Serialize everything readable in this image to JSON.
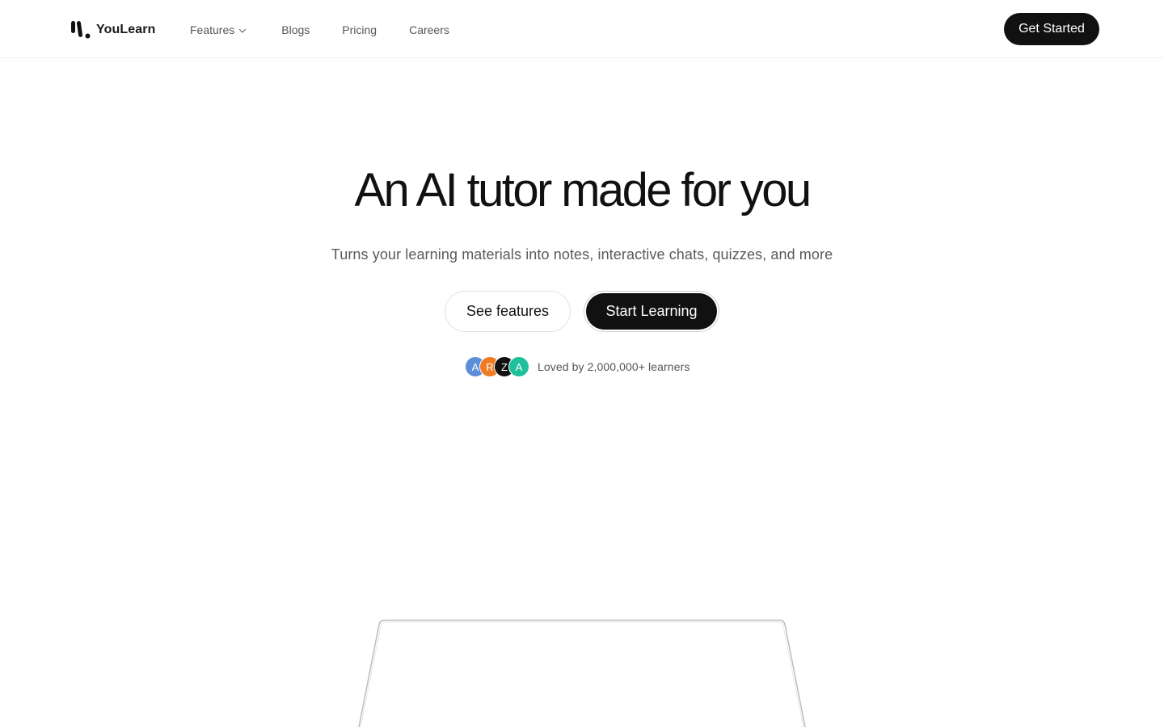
{
  "brand": {
    "name": "YouLearn"
  },
  "nav": {
    "items": [
      {
        "label": "Features",
        "has_dropdown": true
      },
      {
        "label": "Blogs"
      },
      {
        "label": "Pricing"
      },
      {
        "label": "Careers"
      }
    ],
    "cta_label": "Get Started"
  },
  "hero": {
    "title": "An AI tutor made for you",
    "subtitle": "Turns your learning materials into notes, interactive chats, quizzes, and more",
    "secondary_cta": "See features",
    "primary_cta": "Start Learning"
  },
  "social_proof": {
    "avatars": [
      {
        "letter": "A",
        "color": "#5b8dd9"
      },
      {
        "letter": "R",
        "color": "#f07a23"
      },
      {
        "letter": "Z",
        "color": "#111111"
      },
      {
        "letter": "A",
        "color": "#1fbf9c"
      }
    ],
    "text": "Loved by 2,000,000+ learners"
  },
  "colors": {
    "accent": "#111111",
    "muted_text": "#555555",
    "border": "#e2e2e2"
  }
}
